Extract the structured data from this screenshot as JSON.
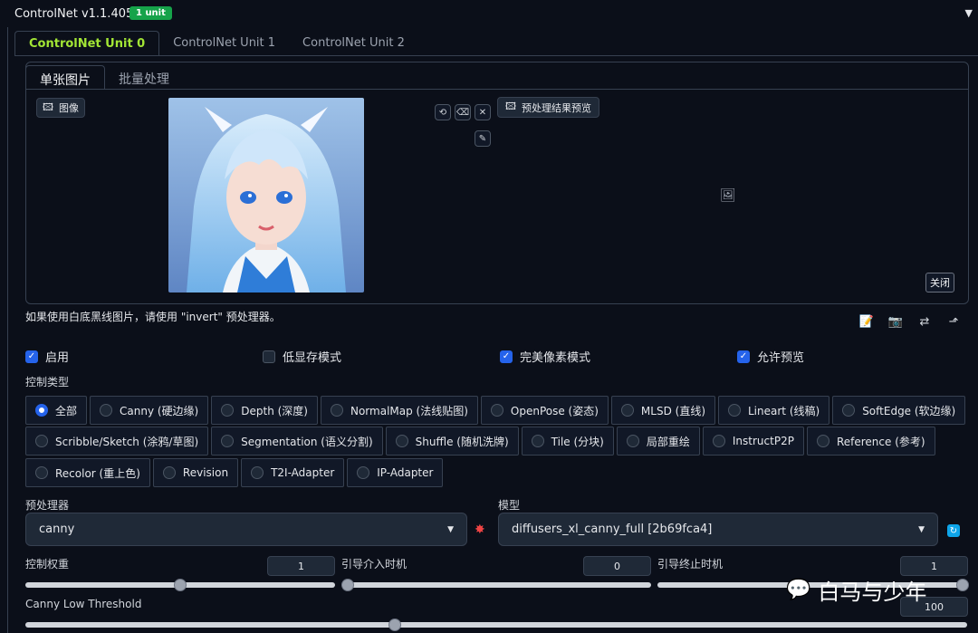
{
  "header": {
    "title": "ControlNet v1.1.405",
    "badge": "1 unit",
    "collapse_icon": "triangle-down-icon"
  },
  "unit_tabs": [
    "ControlNet Unit 0",
    "ControlNet Unit 1",
    "ControlNet Unit 2"
  ],
  "sub_tabs": [
    "单张图片",
    "批量处理"
  ],
  "image_panel": {
    "label": "图像",
    "preview_label": "预处理结果预览",
    "close_label": "关闭"
  },
  "hint": "如果使用白底黑线图片，请使用 \"invert\" 预处理器。",
  "checkboxes": [
    {
      "label": "启用",
      "checked": true
    },
    {
      "label": "低显存模式",
      "checked": false
    },
    {
      "label": "完美像素模式",
      "checked": true
    },
    {
      "label": "允许预览",
      "checked": true
    }
  ],
  "control_type_label": "控制类型",
  "control_types": {
    "row1": [
      "全部",
      "Canny (硬边缘)",
      "Depth (深度)",
      "NormalMap (法线贴图)",
      "OpenPose (姿态)",
      "MLSD (直线)",
      "Lineart (线稿)",
      "SoftEdge (软边缘)"
    ],
    "row2": [
      "Scribble/Sketch (涂鸦/草图)",
      "Segmentation (语义分割)",
      "Shuffle (随机洗牌)",
      "Tile (分块)",
      "局部重绘",
      "InstructP2P",
      "Reference (参考)"
    ],
    "row3": [
      "Recolor (重上色)",
      "Revision",
      "T2I-Adapter",
      "IP-Adapter"
    ],
    "selected": "全部"
  },
  "preprocessor": {
    "label": "预处理器",
    "value": "canny"
  },
  "model": {
    "label": "模型",
    "value": "diffusers_xl_canny_full [2b69fca4]"
  },
  "control_weight": {
    "label": "控制权重",
    "value": "1",
    "fraction": 0.5
  },
  "guidance_start": {
    "label": "引导介入时机",
    "value": "0",
    "fraction": 0.0
  },
  "guidance_end": {
    "label": "引导终止时机",
    "value": "1",
    "fraction": 1.0
  },
  "canny_low": {
    "label": "Canny Low Threshold",
    "value": "100",
    "fraction": 0.39
  },
  "watermark": "白马与少年"
}
